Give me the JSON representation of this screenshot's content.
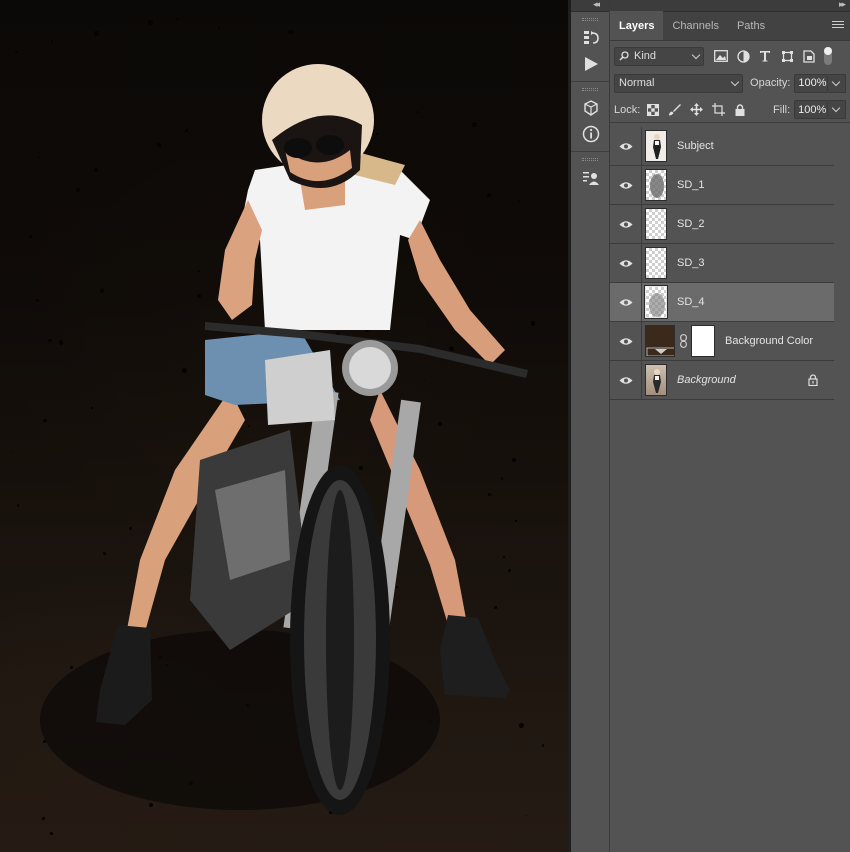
{
  "panel": {
    "tabs": [
      {
        "label": "Layers",
        "active": true
      },
      {
        "label": "Channels",
        "active": false
      },
      {
        "label": "Paths",
        "active": false
      }
    ],
    "filter": {
      "kind_label": "Kind"
    },
    "blend_mode": "Normal",
    "opacity": {
      "label": "Opacity:",
      "value": "100%"
    },
    "lock": {
      "label": "Lock:"
    },
    "fill": {
      "label": "Fill:",
      "value": "100%"
    },
    "layers": [
      {
        "name": "Subject",
        "visible": true,
        "selected": false,
        "italic": false
      },
      {
        "name": "SD_1",
        "visible": true,
        "selected": false,
        "italic": false
      },
      {
        "name": "SD_2",
        "visible": true,
        "selected": false,
        "italic": false
      },
      {
        "name": "SD_3",
        "visible": true,
        "selected": false,
        "italic": false
      },
      {
        "name": "SD_4",
        "visible": true,
        "selected": true,
        "italic": false
      },
      {
        "name": "Background Color",
        "visible": true,
        "selected": false,
        "italic": false,
        "fill_color": "#3b2a1c"
      },
      {
        "name": "Background",
        "visible": true,
        "selected": false,
        "italic": true,
        "locked": true
      }
    ]
  },
  "toolstrip": {
    "icons": [
      "history-icon",
      "actions-play-icon",
      "3d-cube-icon",
      "info-icon",
      "properties-icon"
    ]
  },
  "colors": {
    "panel_bg": "#535353",
    "selected_layer": "#6b6b6b",
    "canvas_bg": "#120d09"
  }
}
